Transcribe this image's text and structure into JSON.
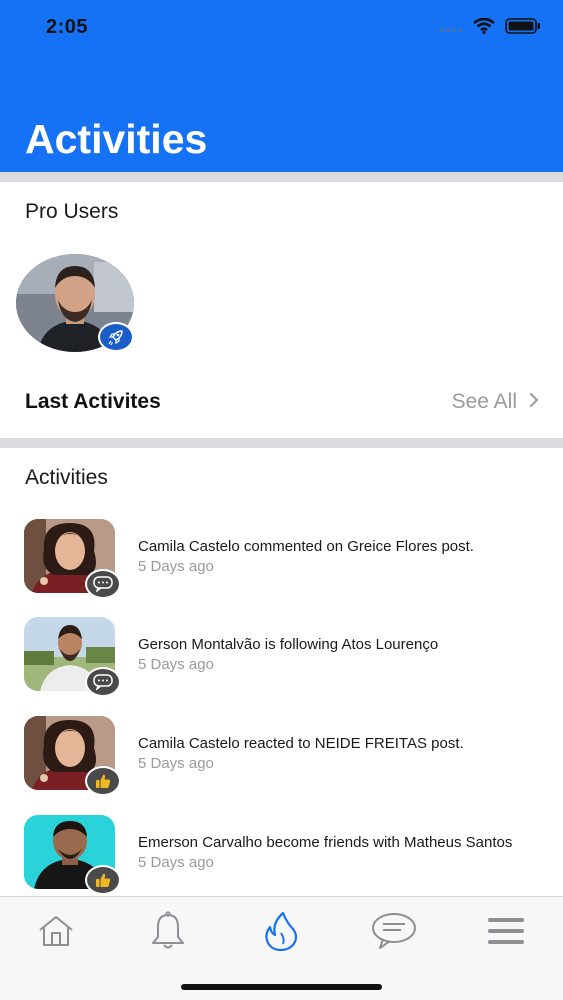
{
  "status_bar": {
    "time": "2:05"
  },
  "header": {
    "title": "Activities"
  },
  "pro_users": {
    "label": "Pro Users"
  },
  "last_activities": {
    "label": "Last Activites",
    "see_all": "See All"
  },
  "activities": {
    "label": "Activities",
    "items": [
      {
        "text": "Camila Castelo commented on Greice Flores post.",
        "time": "5 Days ago",
        "badge": "comment-icon"
      },
      {
        "text": "Gerson Montalvão is following Atos Lourenço",
        "time": "5 Days ago",
        "badge": "comment-icon"
      },
      {
        "text": "Camila Castelo reacted to NEIDE FREITAS post.",
        "time": "5 Days ago",
        "badge": "thumbs-up-icon"
      },
      {
        "text": "Emerson Carvalho become friends with Matheus Santos",
        "time": "5 Days ago",
        "badge": "thumbs-up-icon"
      }
    ]
  },
  "tabbar": {
    "tabs": [
      "home-icon",
      "bell-icon",
      "flame-icon",
      "chat-bubble-icon",
      "menu-icon"
    ],
    "active": "flame-icon"
  },
  "colors": {
    "header": "#1672f4",
    "active_tab": "#1672f4",
    "muted_text": "#9a9a9a",
    "divider": "#dcdcde"
  }
}
